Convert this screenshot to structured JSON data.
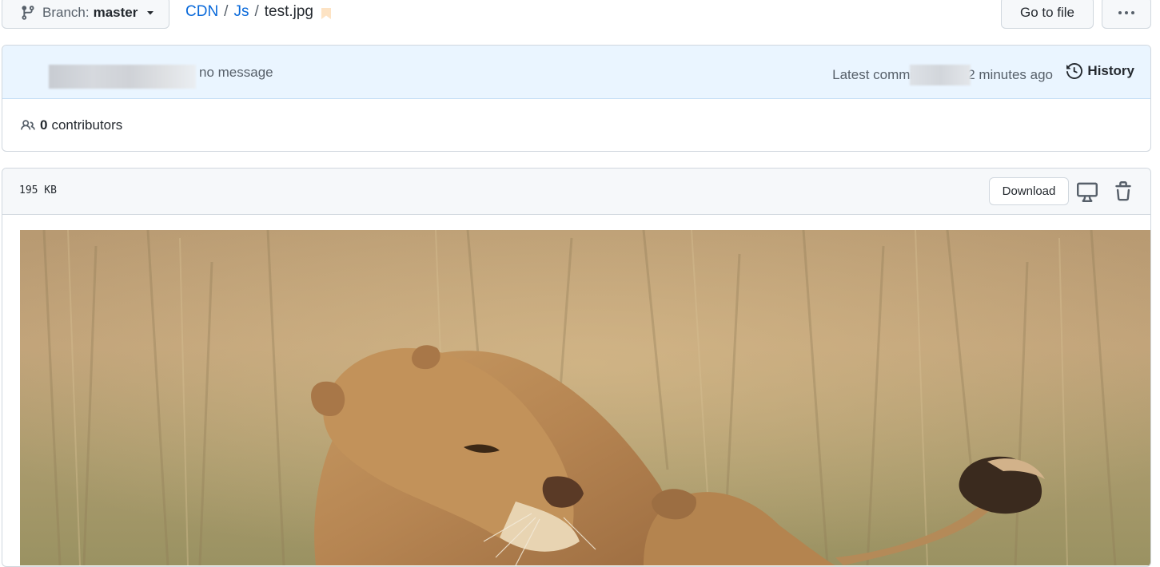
{
  "branch": {
    "prefix": "Branch:",
    "name": "master"
  },
  "breadcrumb": {
    "repo": "CDN",
    "folder": "Js",
    "file": "test.jpg",
    "separator": "/"
  },
  "toolbar": {
    "goto_file_label": "Go to file",
    "more_label": "···"
  },
  "commit": {
    "message": "no message",
    "latest_prefix": "Latest commi",
    "time": "2 minutes ago",
    "history_label": "History"
  },
  "contributors": {
    "count": "0",
    "label": "contributors"
  },
  "file": {
    "size": "195 KB",
    "download_label": "Download"
  },
  "colors": {
    "link": "#0969da",
    "border": "#d0d7de",
    "commit_header_bg": "#eaf5ff",
    "muted_text": "#57606a"
  },
  "icons": {
    "branch": "git-branch-icon",
    "caret": "triangle-down-icon",
    "bookmark": "bookmark-icon",
    "kebab": "kebab-horizontal-icon",
    "history": "history-icon",
    "people": "people-icon",
    "desktop": "device-desktop-icon",
    "trash": "trash-icon"
  }
}
